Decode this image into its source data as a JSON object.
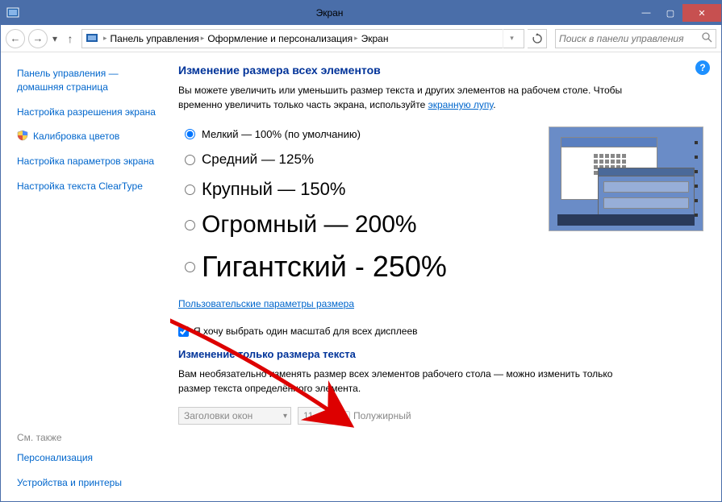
{
  "window": {
    "title": "Экран"
  },
  "titlebar_buttons": {
    "min": "—",
    "max": "▢",
    "close": "✕"
  },
  "breadcrumb": {
    "root": "Панель управления",
    "mid": "Оформление и персонализация",
    "current": "Экран"
  },
  "search": {
    "placeholder": "Поиск в панели управления"
  },
  "sidebar": {
    "home": "Панель управления — домашняя страница",
    "resolution": "Настройка разрешения экрана",
    "calibration": "Калибровка цветов",
    "brightness": "Настройка параметров экрана",
    "cleartype": "Настройка текста ClearType",
    "see_also": "См. также",
    "personalization": "Персонализация",
    "devices": "Устройства и принтеры"
  },
  "main": {
    "heading1": "Изменение размера всех элементов",
    "desc_prefix": "Вы можете увеличить или уменьшить размер текста и других элементов на рабочем столе. Чтобы временно увеличить только часть экрана, используйте ",
    "desc_link": "экранную лупу",
    "desc_suffix": ".",
    "options": [
      {
        "label": "Мелкий — 100% (по умолчанию)",
        "checked": true
      },
      {
        "label": "Средний — 125%",
        "checked": false
      },
      {
        "label": "Крупный — 150%",
        "checked": false
      },
      {
        "label": "Огромный — 200%",
        "checked": false
      },
      {
        "label": "Гигантский - 250%",
        "checked": false
      }
    ],
    "custom_link": "Пользовательские параметры размера",
    "checkbox_label": "Я хочу выбрать один масштаб для всех дисплеев",
    "heading2": "Изменение только размера текста",
    "desc2": "Вам необязательно изменять размер всех элементов рабочего стола — можно изменить только размер текста определённого элемента.",
    "dd_title": "Заголовки окон",
    "dd_size": "11",
    "bold": "Полужирный"
  }
}
